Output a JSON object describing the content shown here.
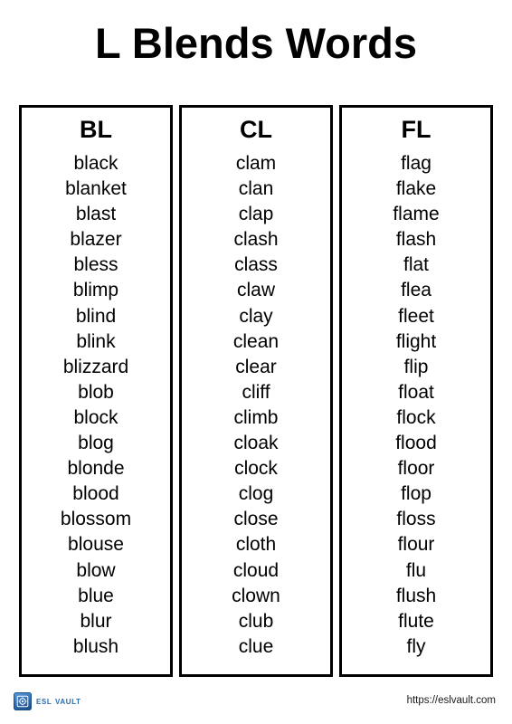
{
  "page": {
    "title": "L Blends Words"
  },
  "columns": [
    {
      "header": "BL",
      "words": [
        "black",
        "blanket",
        "blast",
        "blazer",
        "bless",
        "blimp",
        "blind",
        "blink",
        "blizzard",
        "blob",
        "block",
        "blog",
        "blonde",
        "blood",
        "blossom",
        "blouse",
        "blow",
        "blue",
        "blur",
        "blush"
      ]
    },
    {
      "header": "CL",
      "words": [
        "clam",
        "clan",
        "clap",
        "clash",
        "class",
        "claw",
        "clay",
        "clean",
        "clear",
        "cliff",
        "climb",
        "cloak",
        "clock",
        "clog",
        "close",
        "cloth",
        "cloud",
        "clown",
        "club",
        "clue"
      ]
    },
    {
      "header": "FL",
      "words": [
        "flag",
        "flake",
        "flame",
        "flash",
        "flat",
        "flea",
        "fleet",
        "flight",
        "flip",
        "float",
        "flock",
        "flood",
        "floor",
        "flop",
        "floss",
        "flour",
        "flu",
        "flush",
        "flute",
        "fly"
      ]
    }
  ],
  "footer": {
    "brand_name": "ESL VAULT",
    "brand_icon": "vault-icon",
    "url": "https://eslvault.com"
  },
  "colors": {
    "brand_blue": "#2a6cb0",
    "border": "#000000",
    "text": "#000000",
    "background": "#ffffff"
  }
}
